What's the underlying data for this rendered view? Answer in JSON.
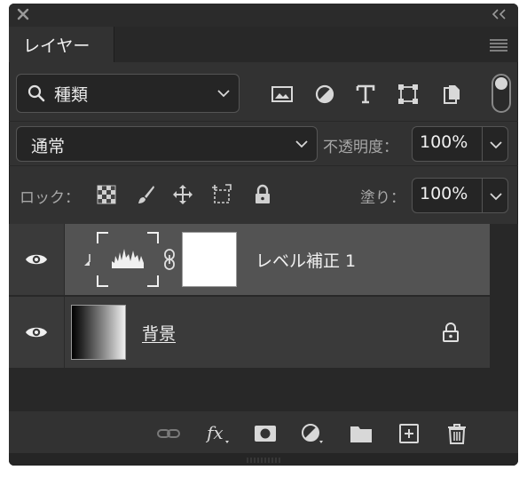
{
  "panel": {
    "tab_label": "レイヤー"
  },
  "filter": {
    "value": "種類",
    "icons": [
      "image-filter-icon",
      "adjustment-filter-icon",
      "type-filter-icon",
      "shape-filter-icon",
      "smart-object-filter-icon"
    ]
  },
  "blend": {
    "mode": "通常",
    "opacity_label": "不透明度：",
    "opacity_value": "100%"
  },
  "lock": {
    "label": "ロック：",
    "fill_label": "塗り：",
    "fill_value": "100%"
  },
  "layers": [
    {
      "name": "レベル補正 1",
      "visible": true,
      "selected": true,
      "type": "adjustment"
    },
    {
      "name": "背景",
      "visible": true,
      "selected": false,
      "locked": true,
      "type": "background"
    }
  ],
  "colors": {
    "panel_bg": "#323232",
    "selected_layer": "#535353",
    "text": "#f0f0f0"
  }
}
